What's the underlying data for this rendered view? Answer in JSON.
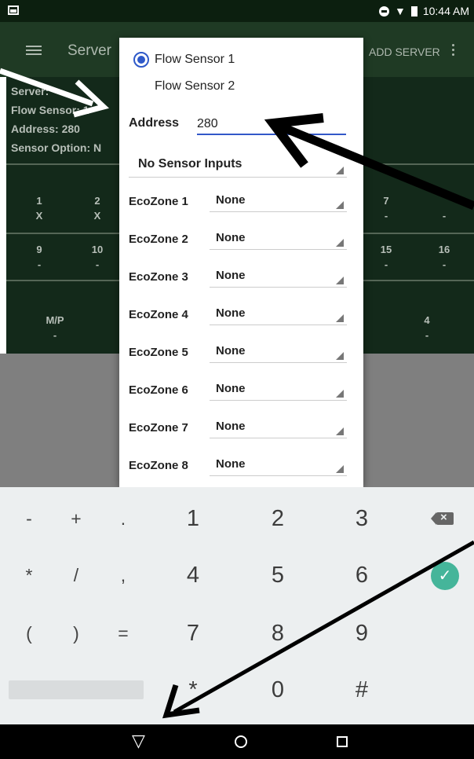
{
  "status_bar": {
    "time": "10:44 AM",
    "icons": [
      "image-icon",
      "do-not-disturb-icon",
      "wifi-icon",
      "battery-icon"
    ]
  },
  "app_bar": {
    "title": "Server",
    "add_server": "ADD SERVER",
    "menu_icon": "hamburger-menu-icon",
    "overflow_icon": "kebab-menu-icon"
  },
  "background": {
    "info": [
      "Server:",
      "Flow Sensor: 1",
      "Address: 280",
      "Sensor Option: N"
    ],
    "zones_row1": [
      {
        "n": "1",
        "v": "X"
      },
      {
        "n": "2",
        "v": "X"
      },
      {
        "n": "7",
        "v": "-"
      },
      {
        "n": "",
        "v": "-"
      }
    ],
    "zones_row2": [
      {
        "n": "9",
        "v": "-"
      },
      {
        "n": "10",
        "v": "-"
      },
      {
        "n": "15",
        "v": "-"
      },
      {
        "n": "16",
        "v": "-"
      }
    ],
    "pumps": [
      {
        "n": "M/P",
        "v": "-"
      },
      {
        "n": "4",
        "v": "-"
      }
    ]
  },
  "dialog": {
    "flow_sensor_1": "Flow Sensor 1",
    "flow_sensor_2": "Flow Sensor 2",
    "address_label": "Address",
    "address_value": "280",
    "sensor_inputs": "No Sensor Inputs",
    "ecozones": [
      {
        "label": "EcoZone 1",
        "value": "None"
      },
      {
        "label": "EcoZone 2",
        "value": "None"
      },
      {
        "label": "EcoZone 3",
        "value": "None"
      },
      {
        "label": "EcoZone 4",
        "value": "None"
      },
      {
        "label": "EcoZone 5",
        "value": "None"
      },
      {
        "label": "EcoZone 6",
        "value": "None"
      },
      {
        "label": "EcoZone 7",
        "value": "None"
      },
      {
        "label": "EcoZone 8",
        "value": "None"
      }
    ]
  },
  "keyboard": {
    "row1": [
      "-",
      "+",
      ".",
      "1",
      "2",
      "3"
    ],
    "row2": [
      "*",
      "/",
      ",",
      "4",
      "5",
      "6"
    ],
    "row3": [
      "(",
      ")",
      "=",
      "7",
      "8",
      "9"
    ],
    "row4": [
      "*",
      "0",
      "#"
    ],
    "enter_icon": "checkmark-icon",
    "delete_icon": "backspace-icon"
  },
  "nav_bar": {
    "back_icon": "back-icon",
    "home_icon": "home-icon",
    "recents_icon": "recents-icon"
  },
  "colors": {
    "app_green": "#1f3a24",
    "accent_blue": "#2e59c9",
    "enter_teal": "#45b59a"
  }
}
